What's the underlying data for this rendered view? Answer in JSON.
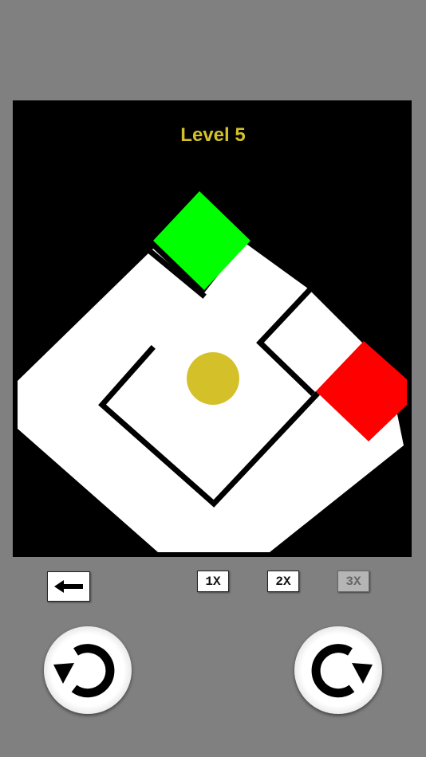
{
  "level": {
    "title": "Level 5"
  },
  "board": {
    "background_color": "#000000",
    "path_color": "#ffffff",
    "start_color": "#00ff00",
    "goal_color": "#ff0000",
    "ball_color": "#d4c12a"
  },
  "controls": {
    "back_icon": "arrow-left-icon",
    "speeds": [
      {
        "label": "1X",
        "enabled": true
      },
      {
        "label": "2X",
        "enabled": true
      },
      {
        "label": "3X",
        "enabled": false
      }
    ],
    "rotate_left_icon": "rotate-counterclockwise-icon",
    "rotate_right_icon": "rotate-clockwise-icon"
  }
}
